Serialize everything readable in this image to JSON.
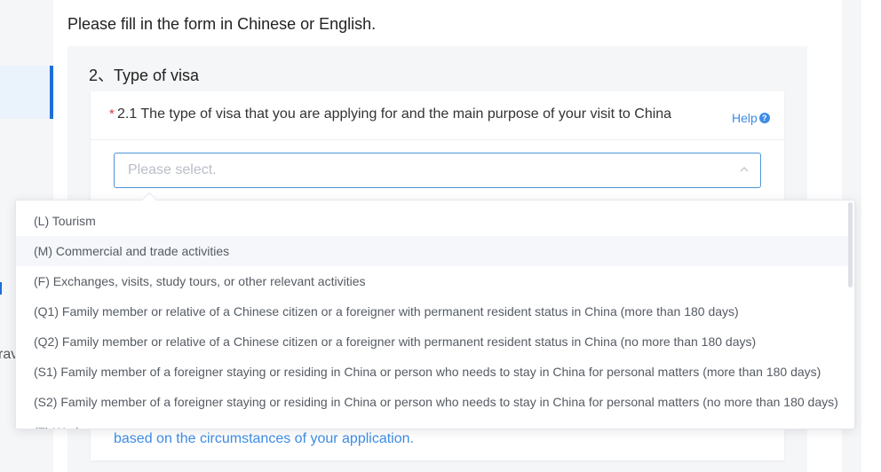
{
  "intro": {
    "text": "Please fill in the form in Chinese or English."
  },
  "sidebar": {
    "clipped_text": "rav"
  },
  "section": {
    "title": "2、Type of visa"
  },
  "question": {
    "required_mark": "*",
    "label": "2.1 The type of visa that you are applying for and the main purpose of your visit to China",
    "help_label": "Help",
    "help_icon": "?"
  },
  "select": {
    "placeholder": "Please select.",
    "arrow_icon": "chevron-up-icon"
  },
  "dropdown": {
    "options": [
      "(L) Tourism",
      "(M) Commercial and trade activities",
      "(F) Exchanges, visits, study tours, or other relevant activities",
      "(Q1) Family member or relative of a Chinese citizen or a foreigner with permanent resident status in China (more than 180 days)",
      "(Q2) Family member or relative of a Chinese citizen or a foreigner with permanent resident status in China (no more than 180 days)",
      "(S1) Family member of a foreigner staying or residing in China or person who needs to stay in China for personal matters (more than 180 days)",
      "(S2) Family member of a foreigner staying or residing in China or person who needs to stay in China for personal matters (no more than 180 days)",
      "(Z) Work"
    ],
    "hovered_index": 1
  },
  "note": {
    "text": "based on the circumstances of your application."
  },
  "colors": {
    "accent": "#3d8ce6",
    "border_active": "#4f94d8",
    "required": "#e0393e",
    "section_bg": "#f5f6f8"
  }
}
